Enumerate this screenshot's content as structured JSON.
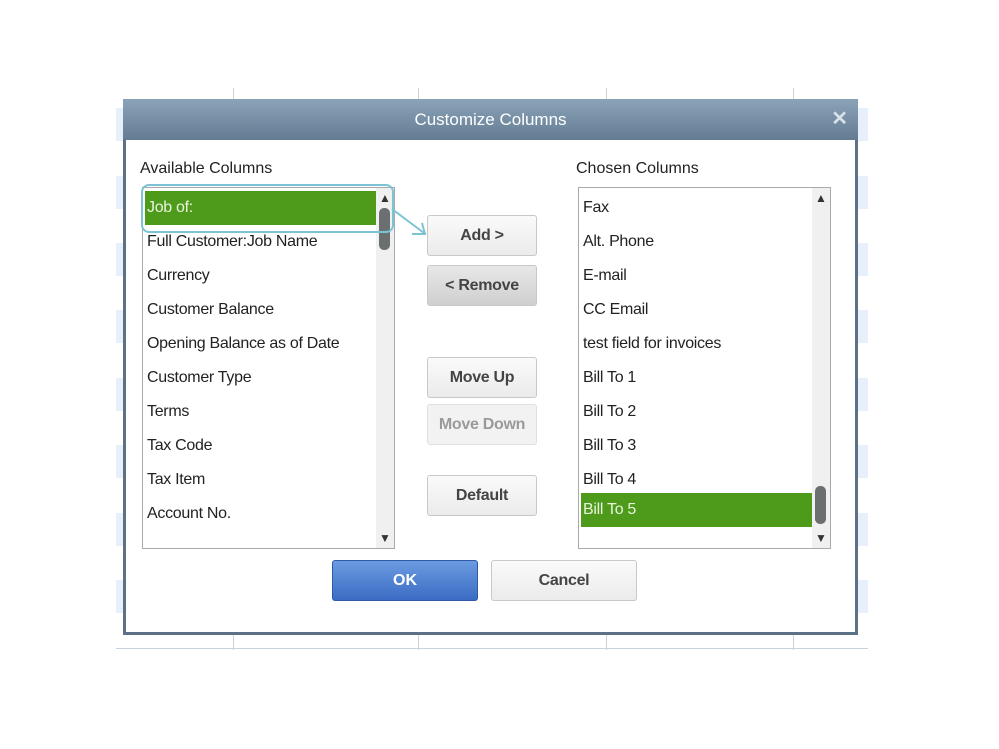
{
  "dialog": {
    "title": "Customize Columns",
    "close_icon": "close-icon",
    "available": {
      "label": "Available Columns",
      "items": [
        "Job of:",
        "Full Customer:Job Name",
        "Currency",
        "Customer Balance",
        "Opening Balance as of Date",
        "Customer Type",
        "Terms",
        "Tax Code",
        "Tax Item",
        "Account No."
      ],
      "selected": "Job of:"
    },
    "chosen": {
      "label": "Chosen Columns",
      "items": [
        "Fax",
        "Alt. Phone",
        "E-mail",
        "CC Email",
        "test field for invoices",
        "Bill To 1",
        "Bill To 2",
        "Bill To 3",
        "Bill To 4",
        "Bill To 5"
      ],
      "selected": "Bill To 5"
    },
    "buttons": {
      "add": "Add >",
      "remove": "< Remove",
      "move_up": "Move Up",
      "move_down": "Move Down",
      "default": "Default",
      "ok": "OK",
      "cancel": "Cancel"
    },
    "colors": {
      "selection": "#4e9a1a",
      "ok": "#3a6cc4",
      "highlight": "#7cc4d4"
    }
  }
}
